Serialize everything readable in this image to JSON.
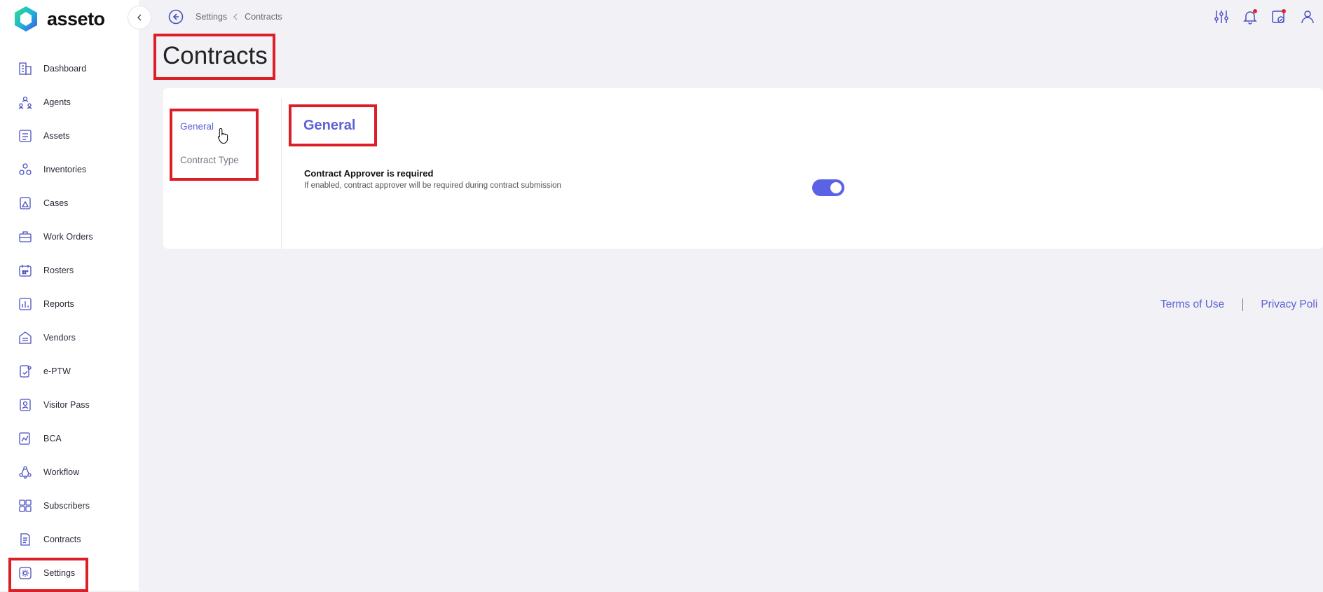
{
  "brand": {
    "name": "asseto"
  },
  "sidebar": {
    "items": [
      {
        "label": "Dashboard"
      },
      {
        "label": "Agents"
      },
      {
        "label": "Assets"
      },
      {
        "label": "Inventories"
      },
      {
        "label": "Cases"
      },
      {
        "label": "Work Orders"
      },
      {
        "label": "Rosters"
      },
      {
        "label": "Reports"
      },
      {
        "label": "Vendors"
      },
      {
        "label": "e-PTW"
      },
      {
        "label": "Visitor Pass"
      },
      {
        "label": "BCA"
      },
      {
        "label": "Workflow"
      },
      {
        "label": "Subscribers"
      },
      {
        "label": "Contracts"
      },
      {
        "label": "Settings",
        "active": true
      }
    ]
  },
  "breadcrumb": {
    "parent": "Settings",
    "current": "Contracts"
  },
  "page": {
    "title": "Contracts"
  },
  "subnav": {
    "general": "General",
    "contract_type": "Contract Type"
  },
  "section": {
    "title": "General",
    "setting_label": "Contract Approver is required",
    "setting_desc": "If enabled, contract approver will be required during contract submission",
    "toggle_on": true
  },
  "footer": {
    "terms": "Terms of Use",
    "privacy": "Privacy Poli"
  },
  "colors": {
    "accent": "#5c62d6",
    "highlight": "#dc1f26",
    "background": "#f2f1f6"
  }
}
